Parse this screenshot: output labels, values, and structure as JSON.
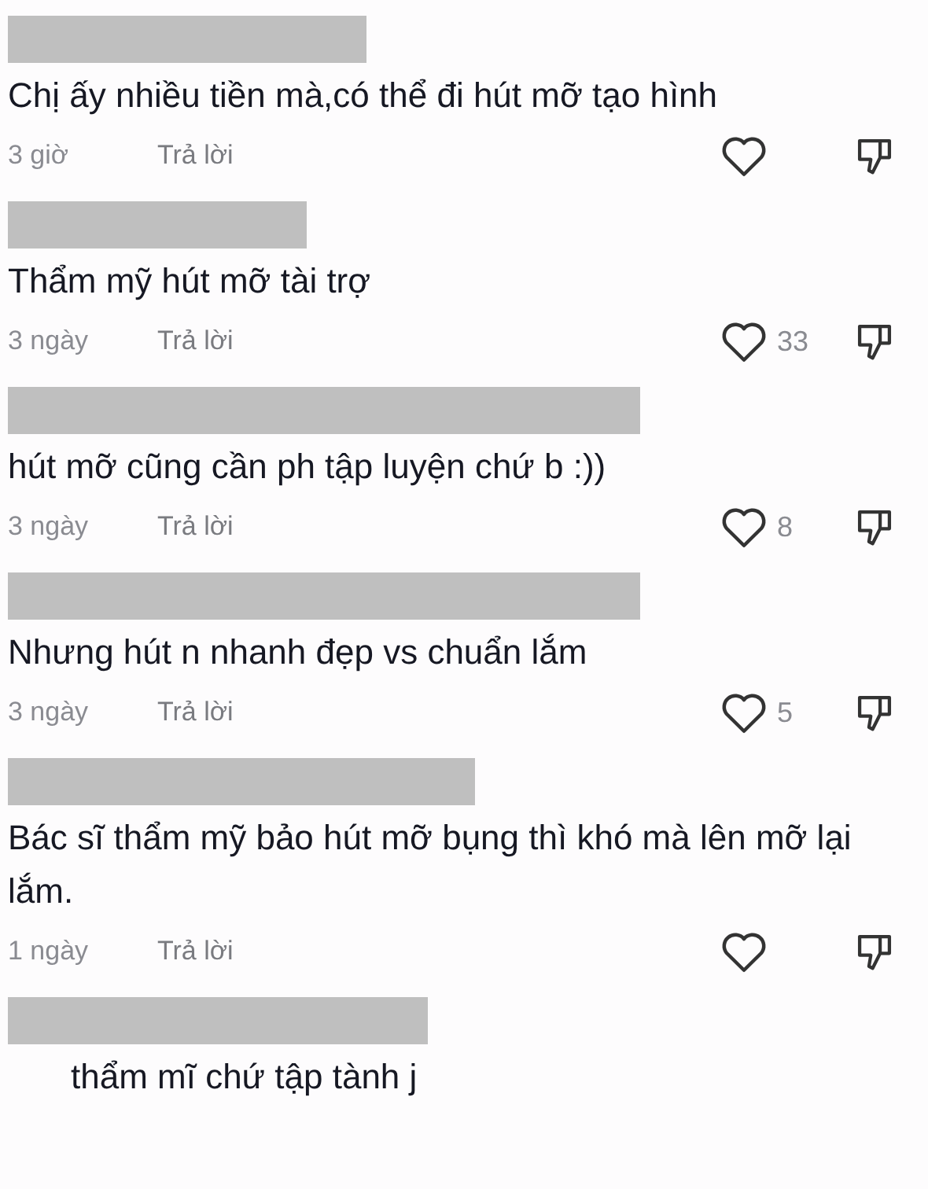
{
  "comments": [
    {
      "kind": "comment",
      "text": "Chị ấy nhiều tiền mà,có thể đi hút mỡ tạo hình",
      "time": "3 giờ",
      "reply": "Trả lời"
    },
    {
      "kind": "comment",
      "text": "Thẩm mỹ hút mỡ tài trợ",
      "time": "3 ngày",
      "reply": "Trả lời",
      "likes": "33"
    },
    {
      "kind": "comment",
      "text": "hút mỡ cũng cần ph tập luyện chứ b :))",
      "time": "3 ngày",
      "reply": "Trả lời",
      "likes": "8"
    },
    {
      "kind": "comment",
      "text": "Nhưng hút n nhanh đẹp vs chuẩn lắm",
      "time": "3 ngày",
      "reply": "Trả lời",
      "likes": "5"
    },
    {
      "kind": "comment",
      "text": "Bác sĩ thẩm mỹ bảo hút mỡ bụng thì khó mà lên mỡ lại lắm.",
      "time": "1 ngày",
      "reply": "Trả lời"
    },
    {
      "kind": "indented",
      "text": "thẩm mĩ chứ tập tành j"
    }
  ]
}
